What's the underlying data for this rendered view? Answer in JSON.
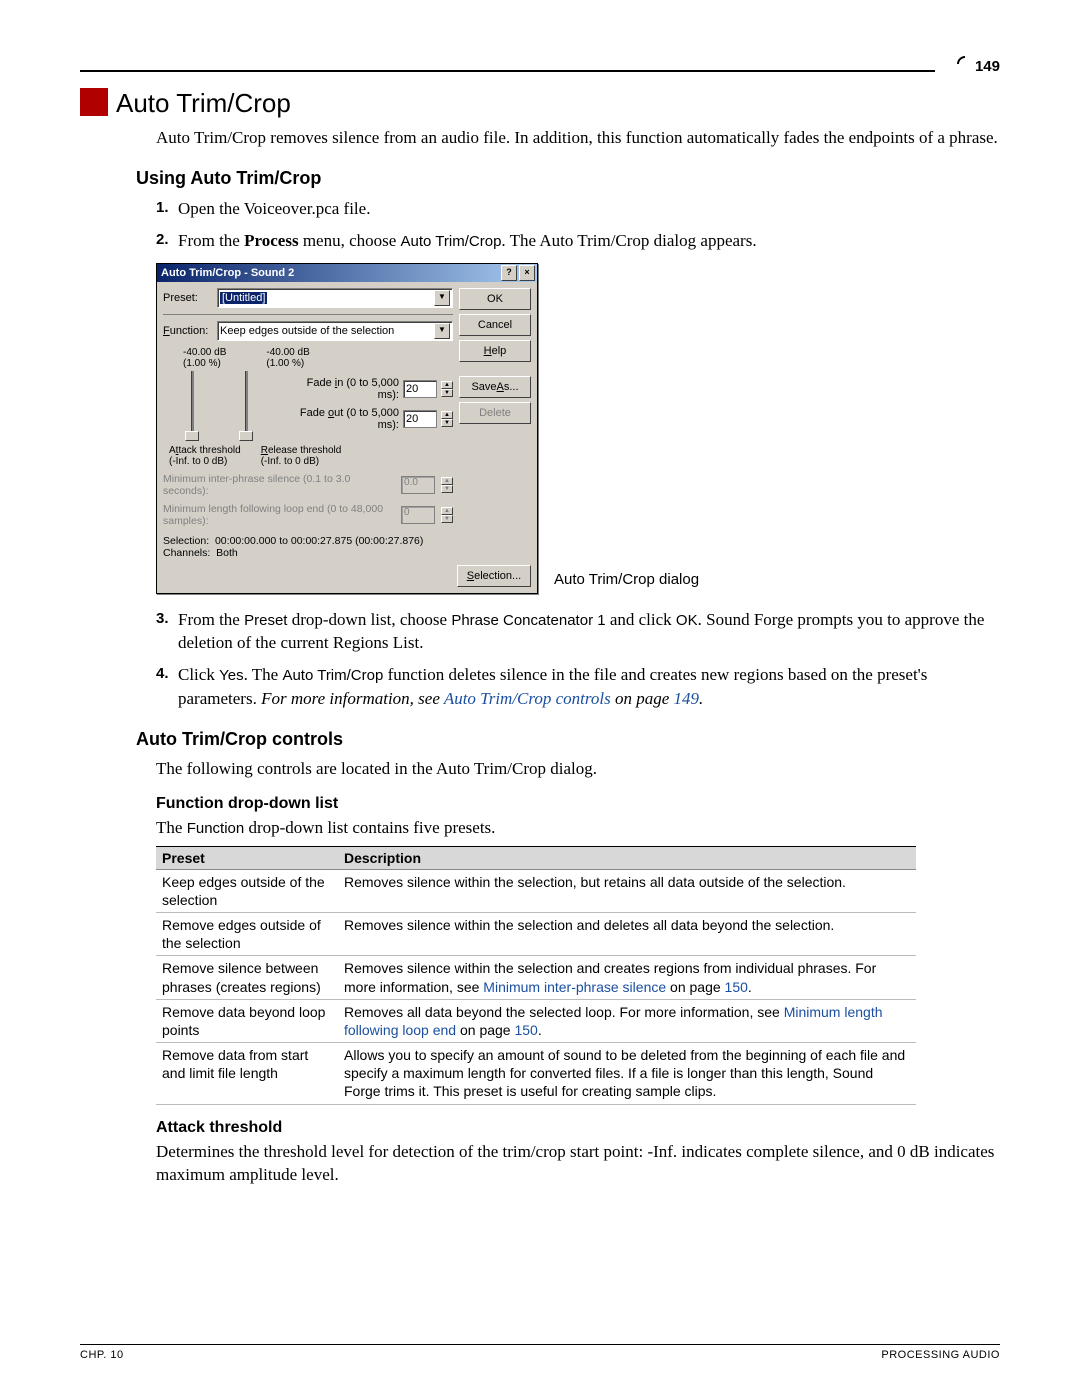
{
  "page_number": "149",
  "title": "Auto Trim/Crop",
  "intro": "Auto Trim/Crop removes silence from an audio file. In addition, this function automatically fades the endpoints of a phrase.",
  "using_heading": "Using Auto Trim/Crop",
  "steps": {
    "s1": "Open the Voiceover.pca file.",
    "s2_a": "From the ",
    "s2_b": "Process",
    "s2_c": " menu, choose ",
    "s2_d": "Auto Trim/Crop",
    "s2_e": ". The Auto Trim/Crop dialog appears.",
    "s3_a": "From the ",
    "s3_b": "Preset",
    "s3_c": " drop-down list, choose ",
    "s3_d": "Phrase Concatenator 1",
    "s3_e": " and click ",
    "s3_f": "OK",
    "s3_g": ". Sound Forge prompts you to approve the deletion of the current Regions List.",
    "s4_a": "Click ",
    "s4_b": "Yes",
    "s4_c": ". The ",
    "s4_d": "Auto Trim/Crop",
    "s4_e": " function deletes silence in the file and creates new regions based on the preset's parameters. ",
    "s4_f": "For more information, see ",
    "s4_g": "Auto Trim/Crop controls",
    "s4_h": " on page ",
    "s4_i": "149",
    "s4_j": "."
  },
  "dialog": {
    "title": "Auto Trim/Crop - Sound 2",
    "preset_label": "Preset:",
    "preset_value": "[Untitled]",
    "function_label": "Function:",
    "function_value": "Keep edges outside of the selection",
    "db1": "-40.00 dB",
    "pct1": "(1.00 %)",
    "db2": "-40.00 dB",
    "pct2": "(1.00 %)",
    "fade_in_label": "Fade in (0 to 5,000 ms):",
    "fade_in_value": "20",
    "fade_out_label": "Fade out (0 to 5,000 ms):",
    "fade_out_value": "20",
    "attack_label1": "Attack threshold",
    "attack_label2": "(-Inf. to 0 dB)",
    "release_label1": "Release threshold",
    "release_label2": "(-Inf. to 0 dB)",
    "min_inter": "Minimum inter-phrase silence (0.1 to 3.0 seconds):",
    "min_inter_val": "0.0",
    "min_loop": "Minimum length following loop end (0 to 48,000 samples):",
    "min_loop_val": "0",
    "selection_label": "Selection:",
    "selection_value": "00:00:00.000 to 00:00:27.875 (00:00:27.876)",
    "channels_label": "Channels:",
    "channels_value": "Both",
    "btn_ok": "OK",
    "btn_cancel": "Cancel",
    "btn_help": "Help",
    "btn_saveas": "Save As...",
    "btn_delete": "Delete",
    "btn_selection": "Selection..."
  },
  "dialog_caption": "Auto Trim/Crop dialog",
  "controls_heading": "Auto Trim/Crop controls",
  "controls_intro": "The following controls are located in the Auto Trim/Crop dialog.",
  "func_heading": "Function drop-down list",
  "func_intro_a": "The ",
  "func_intro_b": "Function",
  "func_intro_c": " drop-down list contains five presets.",
  "table": {
    "h1": "Preset",
    "h2": "Description",
    "rows": [
      {
        "preset": "Keep edges outside of the selection",
        "desc": "Removes silence within the selection, but retains all data outside of the selection."
      },
      {
        "preset": "Remove edges outside of the selection",
        "desc": "Removes silence within the selection and deletes all data beyond the selection."
      },
      {
        "preset": "Remove silence between phrases (creates regions)",
        "desc_a": "Removes silence within the selection and creates regions from individual phrases. For more information, see ",
        "link": "Minimum inter-phrase silence",
        "desc_b": " on page ",
        "page": "150",
        "desc_c": "."
      },
      {
        "preset": "Remove data beyond loop points",
        "desc_a": "Removes all data beyond the selected loop. For more information, see ",
        "link": "Minimum length following loop end",
        "desc_b": " on page ",
        "page": "150",
        "desc_c": "."
      },
      {
        "preset": "Remove data from start and limit file length",
        "desc": "Allows you to specify an amount of sound to be deleted from the beginning of each file and specify a maximum length for converted files. If a file is longer than this length, Sound Forge trims it. This preset is useful for creating sample clips."
      }
    ]
  },
  "attack_heading": "Attack threshold",
  "attack_body": "Determines the threshold level for detection of the trim/crop start point: -Inf. indicates complete silence, and 0 dB indicates maximum amplitude level.",
  "footer_left": "CHP. 10",
  "footer_right": "PROCESSING AUDIO"
}
